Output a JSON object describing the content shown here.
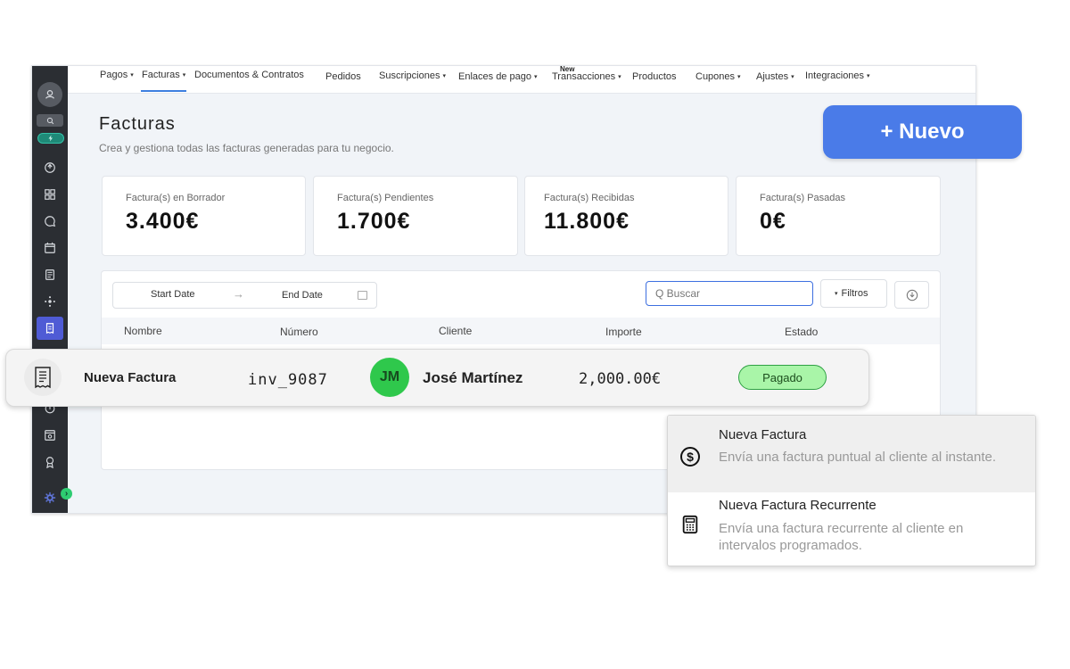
{
  "nav": {
    "items": [
      {
        "label": "Pagos",
        "caret": "▾"
      },
      {
        "label": "Facturas",
        "caret": "▾"
      },
      {
        "label": "Documentos & Contratos",
        "caret": ""
      },
      {
        "label": "Pedidos",
        "caret": ""
      },
      {
        "label": "Suscripciones",
        "caret": "▾"
      },
      {
        "label": "Enlaces de pago",
        "caret": "▾"
      },
      {
        "label": "Transacciones",
        "caret": "▾"
      },
      {
        "label": "Productos",
        "caret": ""
      },
      {
        "label": "Cupones",
        "caret": "▾"
      },
      {
        "label": "Ajustes",
        "caret": "▾"
      },
      {
        "label": "Integraciones",
        "caret": "▾"
      }
    ],
    "new_tag": "New",
    "active": "Facturas"
  },
  "page": {
    "title": "Facturas",
    "subtitle": "Crea y gestiona todas las facturas generadas para tu negocio."
  },
  "new_button": {
    "label": "+ Nuevo"
  },
  "stats": [
    {
      "label": "Factura(s) en Borrador",
      "value": "3.400€"
    },
    {
      "label": "Factura(s) Pendientes",
      "value": "1.700€"
    },
    {
      "label": "Factura(s) Recibidas",
      "value": "11.800€"
    },
    {
      "label": "Factura(s) Pasadas",
      "value": "0€"
    }
  ],
  "toolbar": {
    "start_date": "Start Date",
    "end_date": "End Date",
    "arrow": "→",
    "search_value": "Q Buscar",
    "filters_label": "Filtros",
    "filters_caret": "▾"
  },
  "table": {
    "columns": [
      "Nombre",
      "Número",
      "Cliente",
      "Importe",
      "Estado"
    ],
    "rows": [
      {
        "name": "Nueva Factura",
        "number": "inv_9087",
        "client_initials": "JM",
        "client": "José Martínez",
        "amount": "2,000.00€",
        "status": "Pagado"
      }
    ]
  },
  "menu": {
    "items": [
      {
        "title": "Nueva Factura",
        "description": "Envía una factura puntual al cliente al instante.",
        "icon": "dollar-circle-icon"
      },
      {
        "title": "Nueva Factura Recurrente",
        "description": "Envía una factura recurrente al cliente en intervalos programados.",
        "icon": "calculator-icon"
      }
    ]
  },
  "sidebar": {
    "icons": [
      "account-icon",
      "search-icon",
      "bolt-icon",
      "launchpad-icon",
      "dashboard-icon",
      "conversations-icon",
      "calendar-icon",
      "contacts-icon",
      "automation-icon",
      "payments-icon",
      "sites-icon",
      "reputation-icon",
      "marketplace-icon",
      "settings-icon"
    ],
    "expand_badge": "›"
  },
  "colors": {
    "accent": "#4a7be8",
    "sidebar_bg": "#2b2e33",
    "sidebar_active": "#4f5bd5",
    "paid_bg": "#a9f5a8",
    "paid_border": "#2ea043",
    "avatar_bg": "#2fc84c"
  }
}
